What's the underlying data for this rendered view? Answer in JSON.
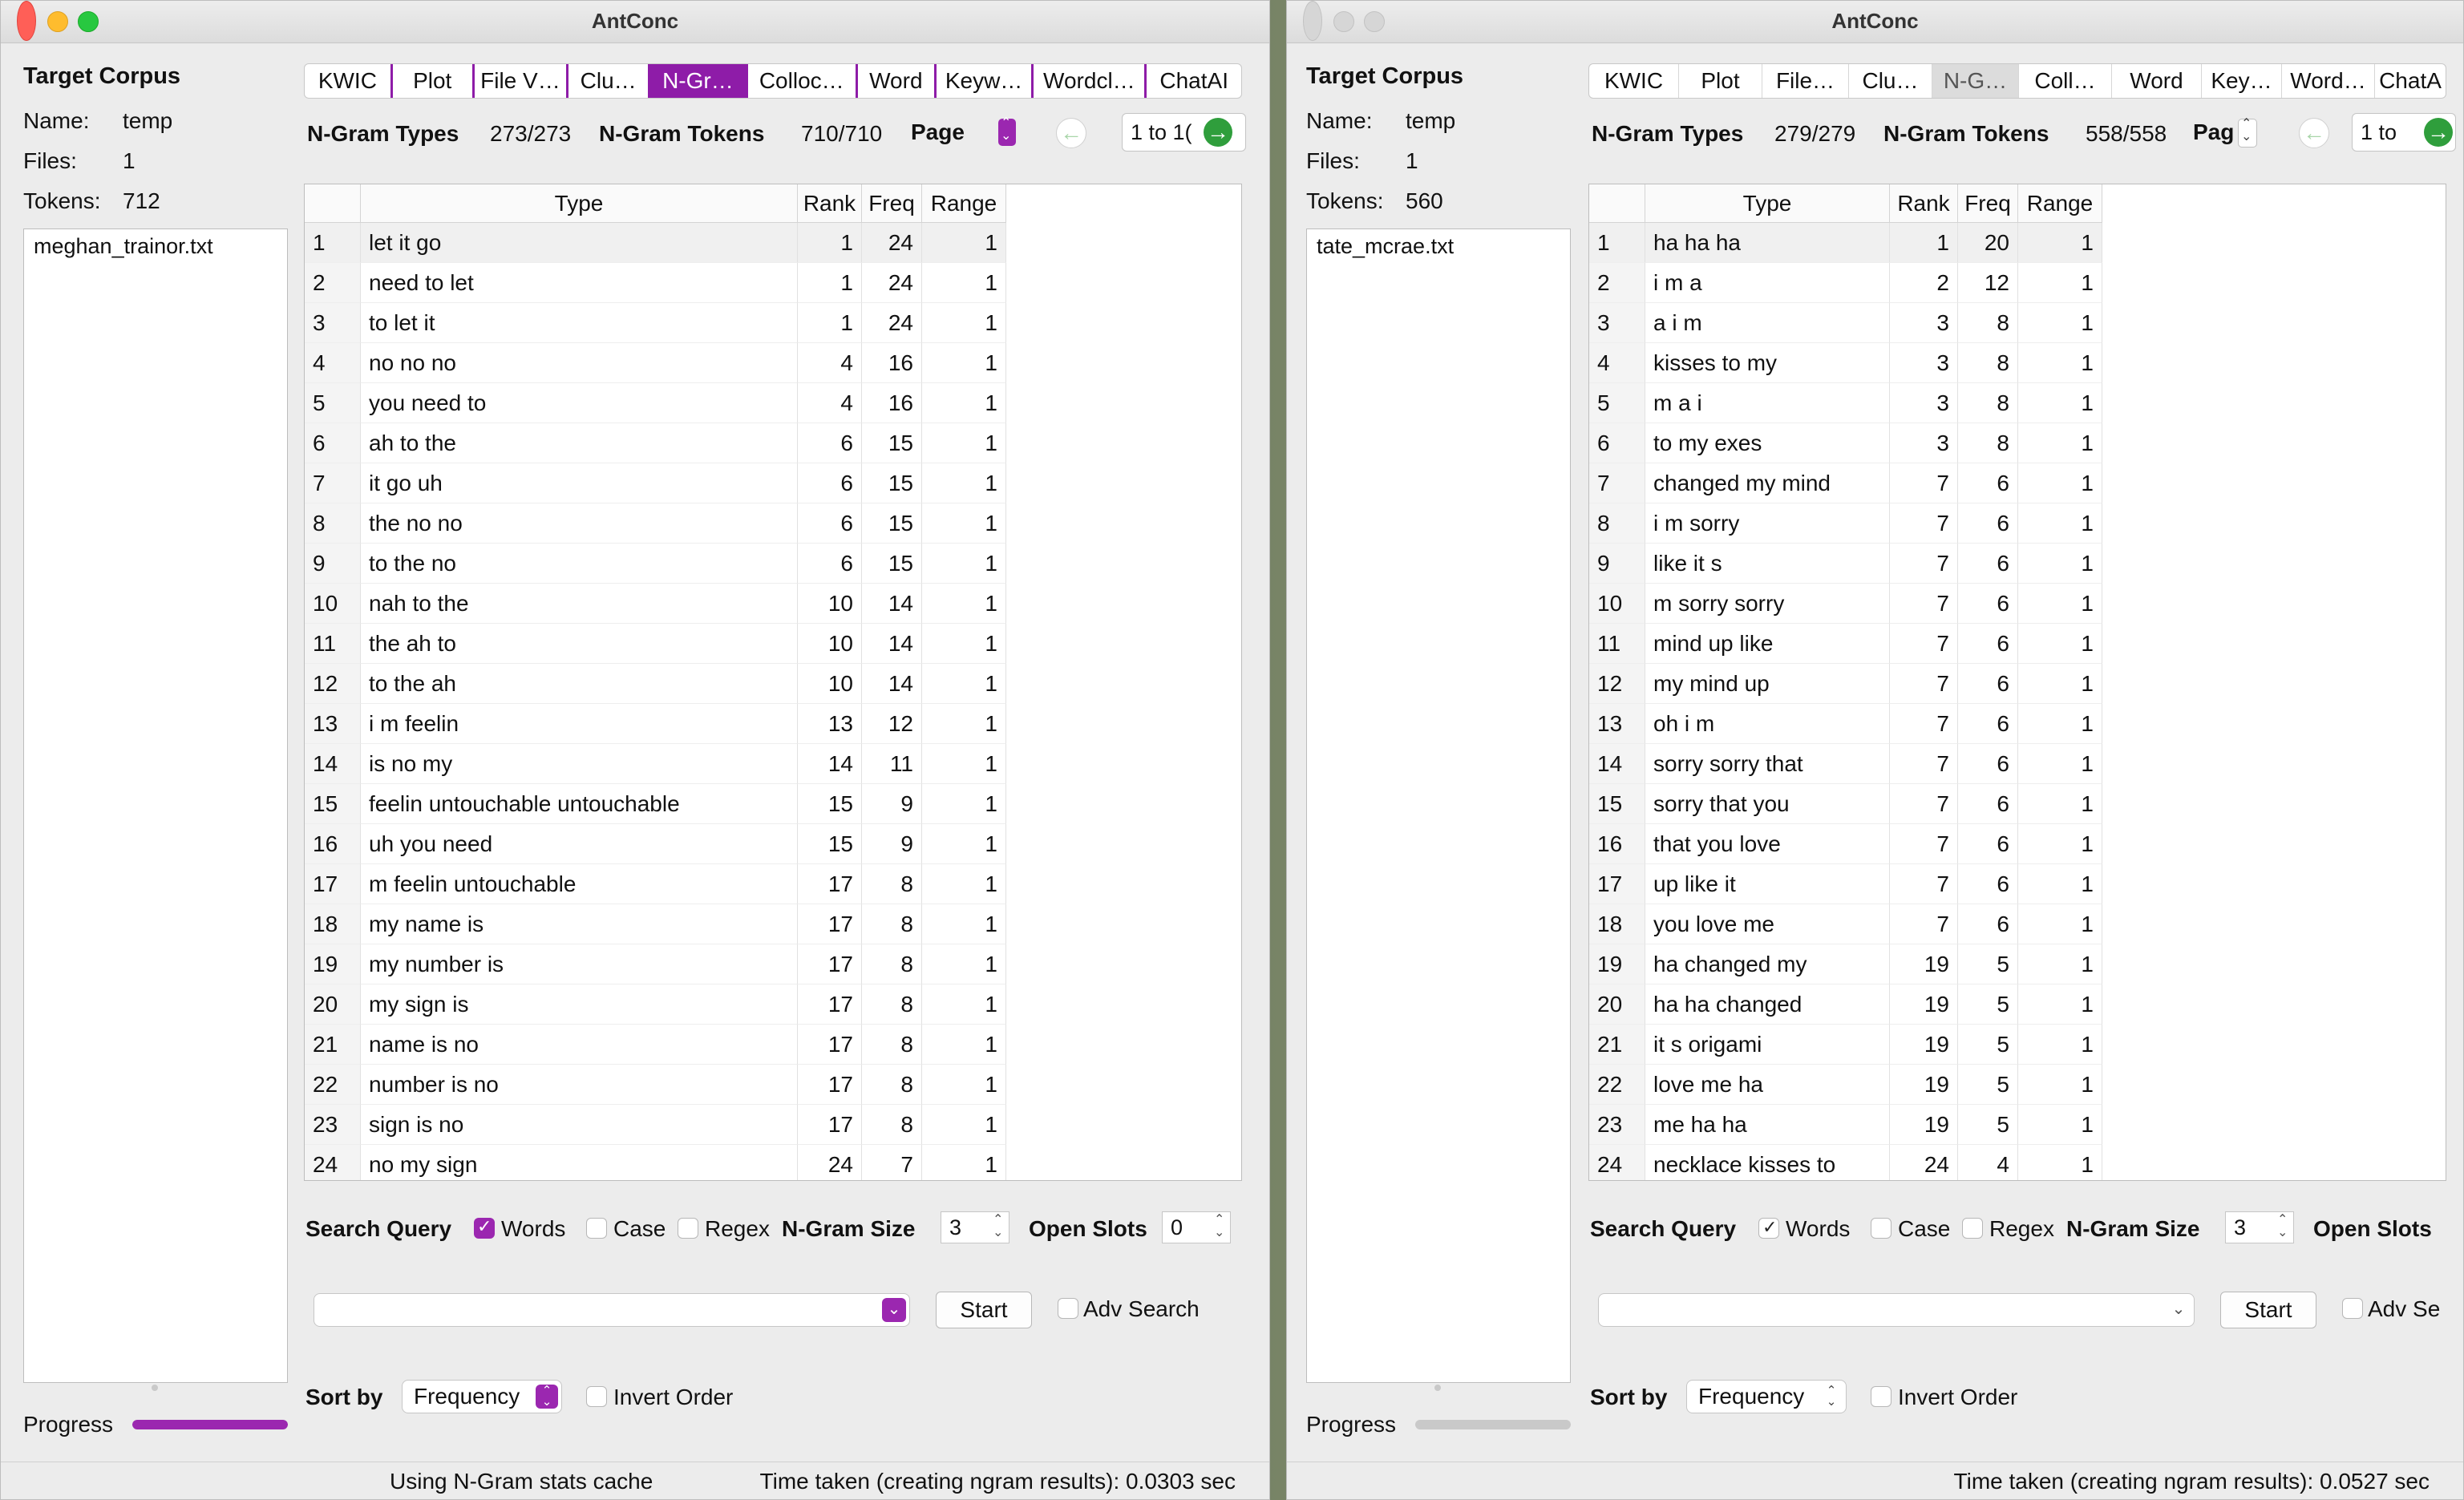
{
  "windows": [
    {
      "id": "left",
      "title": "AntConc",
      "corpus": {
        "heading": "Target Corpus",
        "name_label": "Name:",
        "name": "temp",
        "files_label": "Files:",
        "files": "1",
        "tokens_label": "Tokens:",
        "tokens": "712",
        "file_list": [
          "meghan_trainor.txt"
        ]
      },
      "tabs": [
        "KWIC",
        "Plot",
        "File V…",
        "Clu…",
        "N-Gr…",
        "Colloc…",
        "Word",
        "Keyw…",
        "Wordcl…",
        "ChatAI"
      ],
      "active_tab": "N-Gr…",
      "stats": {
        "types_label": "N-Gram Types",
        "types": "273/273",
        "tokens_label": "N-Gram Tokens",
        "tokens": "710/710",
        "page_label": "Page",
        "range": "1 to 1("
      },
      "columns": [
        "Type",
        "Rank",
        "Freq",
        "Range"
      ],
      "rows": [
        [
          "1",
          "let it go",
          "1",
          "24",
          "1"
        ],
        [
          "2",
          "need to let",
          "1",
          "24",
          "1"
        ],
        [
          "3",
          "to let it",
          "1",
          "24",
          "1"
        ],
        [
          "4",
          "no no no",
          "4",
          "16",
          "1"
        ],
        [
          "5",
          "you need to",
          "4",
          "16",
          "1"
        ],
        [
          "6",
          "ah to the",
          "6",
          "15",
          "1"
        ],
        [
          "7",
          "it go uh",
          "6",
          "15",
          "1"
        ],
        [
          "8",
          "the no no",
          "6",
          "15",
          "1"
        ],
        [
          "9",
          "to the no",
          "6",
          "15",
          "1"
        ],
        [
          "10",
          "nah to the",
          "10",
          "14",
          "1"
        ],
        [
          "11",
          "the ah to",
          "10",
          "14",
          "1"
        ],
        [
          "12",
          "to the ah",
          "10",
          "14",
          "1"
        ],
        [
          "13",
          "i m feelin",
          "13",
          "12",
          "1"
        ],
        [
          "14",
          "is no my",
          "14",
          "11",
          "1"
        ],
        [
          "15",
          "feelin untouchable untouchable",
          "15",
          "9",
          "1"
        ],
        [
          "16",
          "uh you need",
          "15",
          "9",
          "1"
        ],
        [
          "17",
          "m feelin untouchable",
          "17",
          "8",
          "1"
        ],
        [
          "18",
          "my name is",
          "17",
          "8",
          "1"
        ],
        [
          "19",
          "my number is",
          "17",
          "8",
          "1"
        ],
        [
          "20",
          "my sign is",
          "17",
          "8",
          "1"
        ],
        [
          "21",
          "name is no",
          "17",
          "8",
          "1"
        ],
        [
          "22",
          "number is no",
          "17",
          "8",
          "1"
        ],
        [
          "23",
          "sign is no",
          "17",
          "8",
          "1"
        ],
        [
          "24",
          "no my sign",
          "24",
          "7",
          "1"
        ]
      ],
      "search": {
        "label": "Search Query",
        "words": "Words",
        "case": "Case",
        "regex": "Regex",
        "ngram_size_label": "N-Gram Size",
        "ngram_size": "3",
        "open_slots_label": "Open Slots",
        "open_slots": "0",
        "start": "Start",
        "adv_search": "Adv Search"
      },
      "sort": {
        "label": "Sort by",
        "value": "Frequency",
        "invert": "Invert Order"
      },
      "progress": {
        "label": "Progress",
        "value": 1.0
      },
      "status": {
        "cache": "Using N-Gram stats cache",
        "time": "Time taken (creating ngram results):  0.0303 sec"
      },
      "accent_color": "#9b27b0"
    },
    {
      "id": "right",
      "title": "AntConc",
      "corpus": {
        "heading": "Target Corpus",
        "name_label": "Name:",
        "name": "temp",
        "files_label": "Files:",
        "files": "1",
        "tokens_label": "Tokens:",
        "tokens": "560",
        "file_list": [
          "tate_mcrae.txt"
        ]
      },
      "tabs": [
        "KWIC",
        "Plot",
        "File…",
        "Clu…",
        "N-G…",
        "Coll…",
        "Word",
        "Key…",
        "Word…",
        "ChatA"
      ],
      "active_tab": "N-G…",
      "stats": {
        "types_label": "N-Gram Types",
        "types": "279/279",
        "tokens_label": "N-Gram Tokens",
        "tokens": "558/558",
        "page_label": "Pag",
        "range": "1 to"
      },
      "columns": [
        "Type",
        "Rank",
        "Freq",
        "Range"
      ],
      "rows": [
        [
          "1",
          "ha ha ha",
          "1",
          "20",
          "1"
        ],
        [
          "2",
          "i m a",
          "2",
          "12",
          "1"
        ],
        [
          "3",
          "a i m",
          "3",
          "8",
          "1"
        ],
        [
          "4",
          "kisses to my",
          "3",
          "8",
          "1"
        ],
        [
          "5",
          "m a i",
          "3",
          "8",
          "1"
        ],
        [
          "6",
          "to my exes",
          "3",
          "8",
          "1"
        ],
        [
          "7",
          "changed my mind",
          "7",
          "6",
          "1"
        ],
        [
          "8",
          "i m sorry",
          "7",
          "6",
          "1"
        ],
        [
          "9",
          "like it s",
          "7",
          "6",
          "1"
        ],
        [
          "10",
          "m sorry sorry",
          "7",
          "6",
          "1"
        ],
        [
          "11",
          "mind up like",
          "7",
          "6",
          "1"
        ],
        [
          "12",
          "my mind up",
          "7",
          "6",
          "1"
        ],
        [
          "13",
          "oh i m",
          "7",
          "6",
          "1"
        ],
        [
          "14",
          "sorry sorry that",
          "7",
          "6",
          "1"
        ],
        [
          "15",
          "sorry that you",
          "7",
          "6",
          "1"
        ],
        [
          "16",
          "that you love",
          "7",
          "6",
          "1"
        ],
        [
          "17",
          "up like it",
          "7",
          "6",
          "1"
        ],
        [
          "18",
          "you love me",
          "7",
          "6",
          "1"
        ],
        [
          "19",
          "ha changed my",
          "19",
          "5",
          "1"
        ],
        [
          "20",
          "ha ha changed",
          "19",
          "5",
          "1"
        ],
        [
          "21",
          "it s origami",
          "19",
          "5",
          "1"
        ],
        [
          "22",
          "love me ha",
          "19",
          "5",
          "1"
        ],
        [
          "23",
          "me ha ha",
          "19",
          "5",
          "1"
        ],
        [
          "24",
          "necklace kisses to",
          "24",
          "4",
          "1"
        ]
      ],
      "search": {
        "label": "Search Query",
        "words": "Words",
        "case": "Case",
        "regex": "Regex",
        "ngram_size_label": "N-Gram Size",
        "ngram_size": "3",
        "open_slots_label": "Open Slots",
        "open_slots": "",
        "start": "Start",
        "adv_search": "Adv Se"
      },
      "sort": {
        "label": "Sort by",
        "value": "Frequency",
        "invert": "Invert Order"
      },
      "progress": {
        "label": "Progress",
        "value": 0.0
      },
      "status": {
        "cache": "",
        "time": "Time taken (creating ngram results):  0.0527 sec"
      },
      "accent_color": "#bdbdbd"
    }
  ]
}
